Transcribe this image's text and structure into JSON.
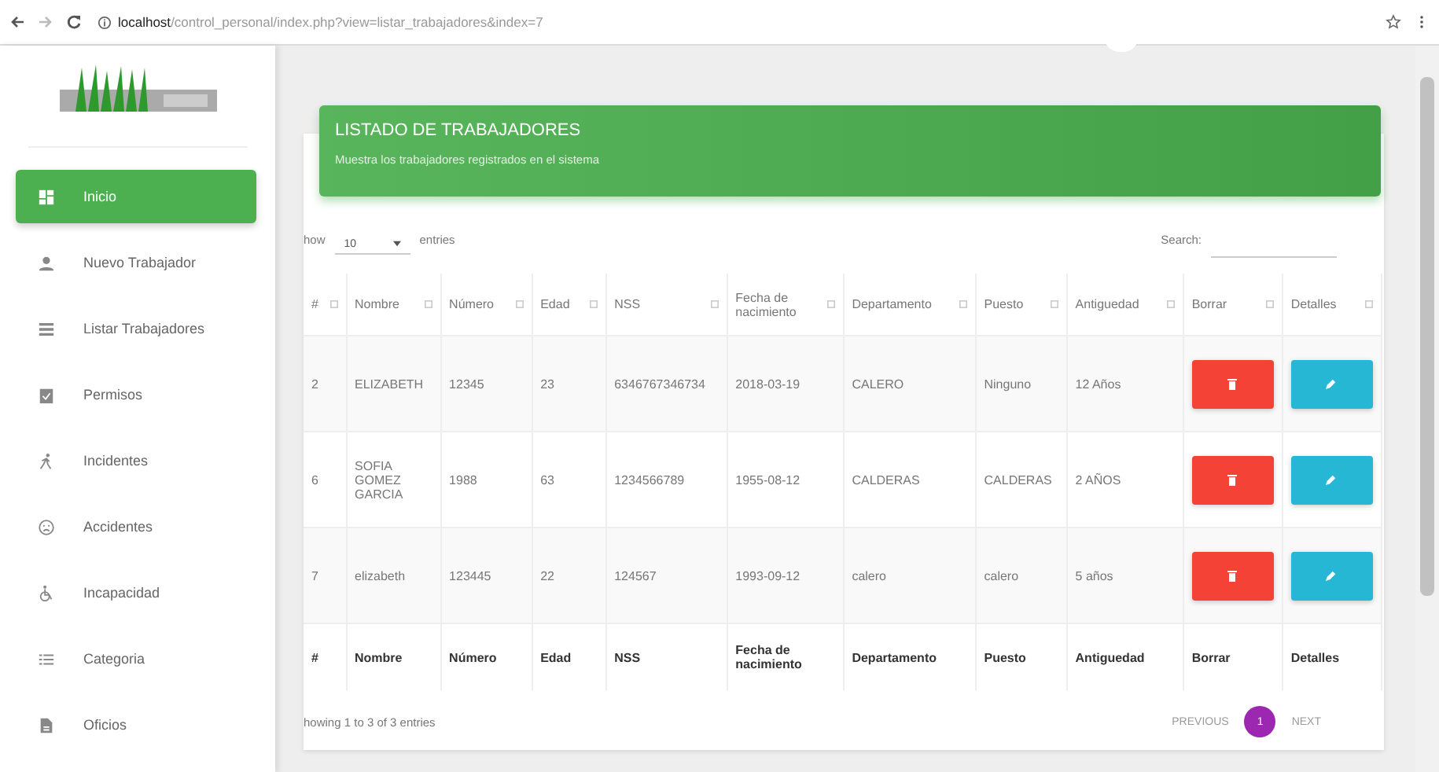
{
  "browser": {
    "url_host": "localhost",
    "url_path": "/control_personal/index.php?view=listar_trabajadores&index=7"
  },
  "sidebar": {
    "items": [
      {
        "label": "Inicio",
        "kind": "dashboard",
        "selected": true
      },
      {
        "label": "Nuevo Trabajador",
        "kind": "person",
        "selected": false
      },
      {
        "label": "Listar Trabajadores",
        "kind": "list",
        "selected": false
      },
      {
        "label": "Permisos",
        "kind": "clipboard",
        "selected": false
      },
      {
        "label": "Incidentes",
        "kind": "runner",
        "selected": false
      },
      {
        "label": "Accidentes",
        "kind": "sad",
        "selected": false
      },
      {
        "label": "Incapacidad",
        "kind": "wheelchair",
        "selected": false
      },
      {
        "label": "Categoria",
        "kind": "lines",
        "selected": false
      },
      {
        "label": "Oficios",
        "kind": "document",
        "selected": false
      }
    ]
  },
  "header": {
    "title": "LISTADO DE TRABAJADORES",
    "subtitle": "Muestra los trabajadores registrados en el sistema"
  },
  "table_controls": {
    "show_label": "how",
    "page_size": "10",
    "entries_label": "entries",
    "search_label": "Search:"
  },
  "table": {
    "columns": [
      "#",
      "Nombre",
      "Número",
      "Edad",
      "NSS",
      "Fecha de nacimiento",
      "Departamento",
      "Puesto",
      "Antiguedad",
      "Borrar",
      "Detalles"
    ],
    "rows": [
      [
        "2",
        "ELIZABETH",
        "12345",
        "23",
        "6346767346734",
        "2018-03-19",
        "CALERO",
        "Ninguno",
        "12 Años"
      ],
      [
        "6",
        "SOFIA GOMEZ GARCIA",
        "1988",
        "63",
        "1234566789",
        "1955-08-12",
        "CALDERAS",
        "CALDERAS",
        "2 AÑOS"
      ],
      [
        "7",
        "elizabeth",
        "123445",
        "22",
        "124567",
        "1993-09-12",
        "calero",
        "calero",
        "5 años"
      ]
    ],
    "footer": [
      "#",
      "Nombre",
      "Número",
      "Edad",
      "NSS",
      "Fecha de nacimiento",
      "Departamento",
      "Puesto",
      "Antiguedad",
      "Borrar",
      "Detalles"
    ]
  },
  "pagination": {
    "info": "howing 1 to 3 of 3 entries",
    "previous": "PREVIOUS",
    "pages": [
      {
        "label": "1",
        "selected": true
      }
    ],
    "next": "NEXT"
  }
}
